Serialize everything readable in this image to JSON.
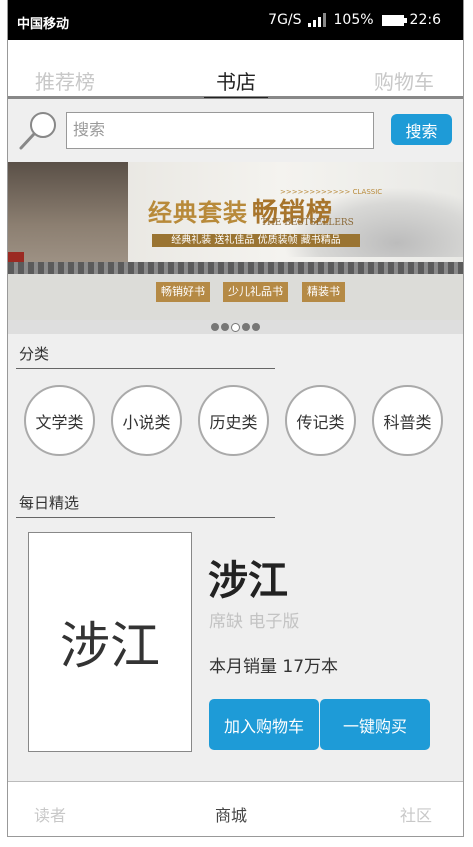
{
  "status_bar": {
    "carrier": "中国移动",
    "network": "7G/S",
    "battery": "105%",
    "time": "22:6"
  },
  "top_nav": {
    "tabs": [
      {
        "label": "推荐榜",
        "active": false
      },
      {
        "label": "书店",
        "active": true
      },
      {
        "label": "购物车",
        "active": false
      }
    ]
  },
  "search": {
    "placeholder": "搜索",
    "button_label": "搜索"
  },
  "banner": {
    "title": "经典套装",
    "title_highlight": "畅销榜",
    "classic": ">>>>>>>>>>>> CLASSIC",
    "subtitle_en": "THE BESTSELLERS",
    "strip_text": "经典礼装  送礼佳品  优质装帧  藏书精品",
    "tags": [
      "畅销好书",
      "少儿礼品书",
      "精装书"
    ],
    "pager": {
      "count": 5,
      "active": 2
    }
  },
  "categories": {
    "title": "分类",
    "items": [
      "文学类",
      "小说类",
      "历史类",
      "传记类",
      "科普类"
    ]
  },
  "daily_pick": {
    "title": "每日精选",
    "cover_text": "涉江",
    "book_title": "涉江",
    "meta": "席缺 电子版",
    "sales": "本月销量  17万本",
    "add_to_cart": "加入购物车",
    "buy_now": "一键购买"
  },
  "bottom_nav": {
    "tabs": [
      {
        "label": "读者",
        "active": false
      },
      {
        "label": "商城",
        "active": true
      },
      {
        "label": "社区",
        "active": false
      }
    ]
  },
  "colors": {
    "accent": "#1e9bd7",
    "banner_gold": "#b88a3a"
  }
}
